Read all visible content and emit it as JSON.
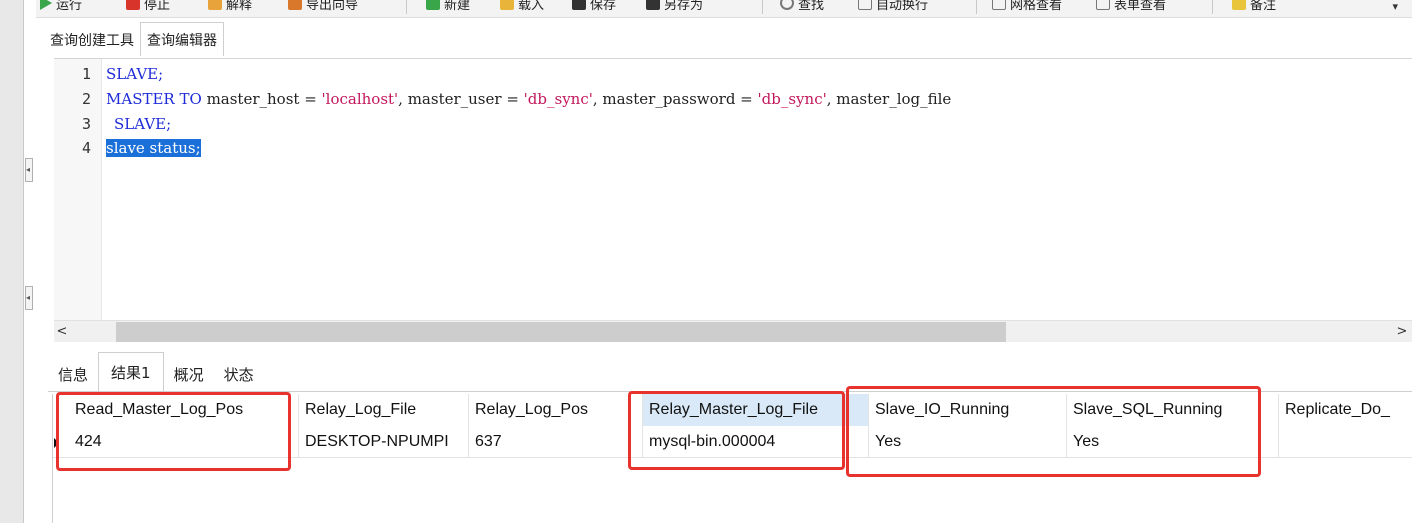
{
  "toolbar": {
    "items": [
      {
        "label": "运行",
        "icon": "play-icon",
        "color": "#3aa64a"
      },
      {
        "label": "停止",
        "icon": "stop-icon",
        "color": "#d9342b"
      },
      {
        "label": "解释",
        "icon": "explain-icon",
        "color": "#e8a33a"
      },
      {
        "label": "导出向导",
        "icon": "export-icon",
        "color": "#d9772b"
      },
      {
        "label": "新建",
        "icon": "new-icon",
        "color": "#3aa64a"
      },
      {
        "label": "载入",
        "icon": "load-icon",
        "color": "#e8b53a"
      },
      {
        "label": "保存",
        "icon": "save-icon",
        "color": "#333333"
      },
      {
        "label": "另存为",
        "icon": "save-as-icon",
        "color": "#333333"
      },
      {
        "label": "查找",
        "icon": "find-icon",
        "color": "#777777"
      },
      {
        "label": "自动换行",
        "icon": "wrap-icon",
        "color": "#777777"
      },
      {
        "label": "网格查看",
        "icon": "grid-view-icon",
        "color": "#777777"
      },
      {
        "label": "表单查看",
        "icon": "form-view-icon",
        "color": "#777777"
      },
      {
        "label": "备注",
        "icon": "note-icon",
        "color": "#e8c53a"
      }
    ],
    "more_glyph": "▾"
  },
  "editor_tabs": [
    {
      "label": "查询创建工具"
    },
    {
      "label": "查询编辑器"
    }
  ],
  "editor": {
    "line_numbers": [
      "1",
      "2",
      "3",
      "4"
    ],
    "lines": {
      "l1_kw": "SLAVE;",
      "l2_a": "MASTER TO",
      "l2_b": " master_host = ",
      "l2_c": "'localhost'",
      "l2_d": ", master_user = ",
      "l2_e": "'db_sync'",
      "l2_f": ", master_password = ",
      "l2_g": "'db_sync'",
      "l2_h": ", master_log_file",
      "l3_kw": "SLAVE;",
      "l4_sel": "slave status;"
    }
  },
  "scrollbar": {
    "left_arrow": "<",
    "right_arrow": ">"
  },
  "result_tabs": [
    {
      "label": "信息"
    },
    {
      "label": "结果1"
    },
    {
      "label": "概况"
    },
    {
      "label": "状态"
    }
  ],
  "grid": {
    "columns": [
      "Read_Master_Log_Pos",
      "Relay_Log_File",
      "Relay_Log_Pos",
      "Relay_Master_Log_File",
      "Slave_IO_Running",
      "Slave_SQL_Running",
      "Replicate_Do_"
    ],
    "row": [
      "424",
      "DESKTOP-NPUMPI",
      "637",
      "mysql-bin.000004",
      "Yes",
      "Yes",
      ""
    ]
  },
  "colors": {
    "highlight": "#e8322d",
    "selection": "#1a6fd8",
    "keyword": "#1e2bd8",
    "string": "#c2185b"
  }
}
